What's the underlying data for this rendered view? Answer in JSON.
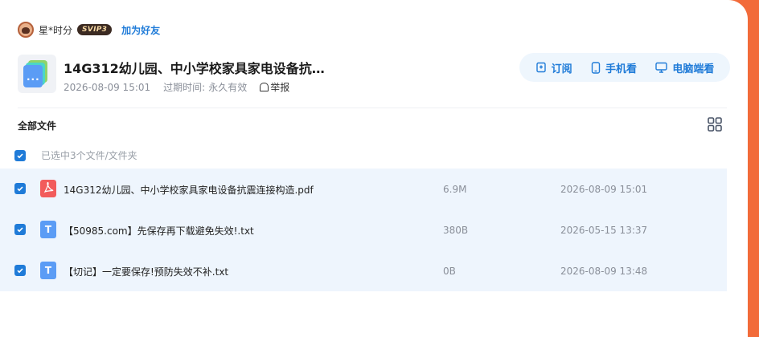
{
  "user": {
    "name": "星*时分",
    "badge": "SVIP3",
    "add_friend": "加为好友"
  },
  "share": {
    "title": "14G312幼儿园、中小学校家具家电设备抗…",
    "date": "2026-08-09 15:01",
    "expire_label": "过期时间:",
    "expire_value": "永久有效",
    "report": "举报"
  },
  "actions": {
    "subscribe": "订阅",
    "phone": "手机看",
    "pc": "电脑端看"
  },
  "section": {
    "title": "全部文件"
  },
  "selection": {
    "text": "已选中3个文件/文件夹"
  },
  "files": [
    {
      "name": "14G312幼儿园、中小学校家具家电设备抗震连接构造.pdf",
      "size": "6.9M",
      "date": "2026-08-09 15:01",
      "type": "pdf"
    },
    {
      "name": "【50985.com】先保存再下载避免失效!.txt",
      "size": "380B",
      "date": "2026-05-15 13:37",
      "type": "txt",
      "icon_letter": "T"
    },
    {
      "name": "【切记】一定要保存!预防失效不补.txt",
      "size": "0B",
      "date": "2026-08-09 13:48",
      "type": "txt",
      "icon_letter": "T"
    }
  ],
  "colors": {
    "accent": "#1f7bd8",
    "background": "#f26b3a",
    "row_selected": "#eef5fd"
  }
}
